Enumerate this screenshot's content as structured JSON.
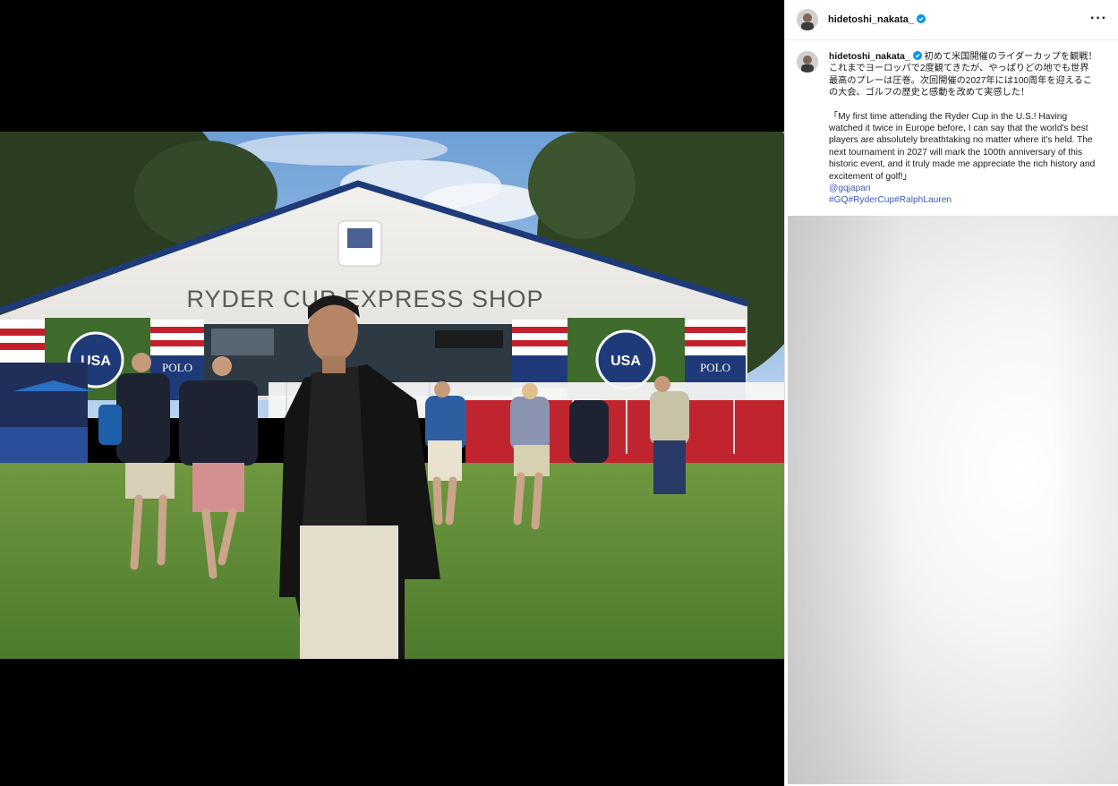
{
  "post": {
    "username": "hidetoshi_nakata_",
    "verified": true,
    "more_icon": "more-horizontal-icon",
    "caption_jp": "初めて米国開催のライダーカップを観戦！これまでヨーロッパで2度観てきたが、やっぱりどの地でも世界最高のプレーは圧巻。次回開催の2027年には100周年を迎えるこの大会、ゴルフの歴史と感動を改めて実感した！",
    "caption_en": "「My first time attending the Ryder Cup in the U.S.! Having watched it twice in Europe before, I can say that the world's best players are absolutely breathtaking no matter where it's held. The next tournament in 2027 will mark the 100th anniversary of this historic event, and it truly made me appreciate the rich history and excitement of golf!」",
    "mention": "@gqjapan",
    "hashtags": [
      "#GQ",
      "#RyderCup",
      "#RalphLauren"
    ]
  },
  "photo": {
    "tent_sign": "RYDER CUP EXPRESS SHOP",
    "banner_text": "POLO",
    "logo_text": "USA"
  },
  "colors": {
    "accent_link": "#3b5bbf",
    "verified_blue": "#0095f6",
    "tent_roof": "#1f3a78"
  }
}
